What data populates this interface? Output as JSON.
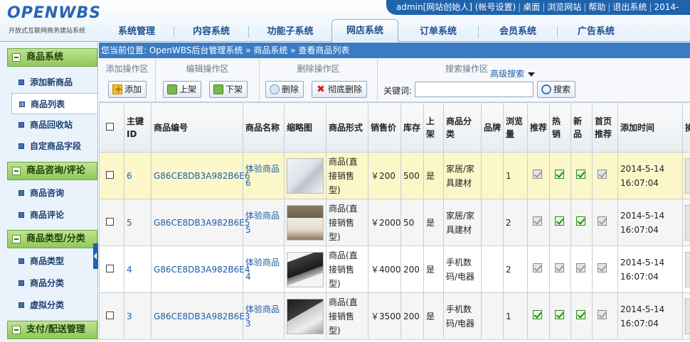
{
  "logo": {
    "brand": "OPENWBS",
    "tagline": "开放式互联网商务建站系统"
  },
  "topbar": {
    "links": [
      "admin[网站创始人] (帐号设置)",
      "桌面",
      "浏览网站",
      "帮助",
      "退出系统",
      "2014-"
    ]
  },
  "nav": {
    "tabs": [
      "系统管理",
      "内容系统",
      "功能子系统",
      "网店系统",
      "订单系统",
      "会员系统",
      "广告系统"
    ],
    "active": "网店系统"
  },
  "sidebar": {
    "sections": [
      {
        "title": "商品系统",
        "items": [
          "添加新商品",
          "商品列表",
          "商品回收站",
          "自定商品字段"
        ]
      },
      {
        "title": "商品咨询/评论",
        "items": [
          "商品咨询",
          "商品评论"
        ]
      },
      {
        "title": "商品类型/分类",
        "items": [
          "商品类型",
          "商品分类",
          "虚拟分类"
        ]
      },
      {
        "title": "支付/配送管理",
        "items": []
      }
    ],
    "active_item": "商品列表"
  },
  "breadcrumb": "您当前位置: OpenWBS后台管理系统 » 商品系统 » 查看商品列表",
  "toolbar": {
    "add_group": "添加操作区",
    "add_btn": "添加",
    "edit_group": "编辑操作区",
    "up_btn": "上架",
    "down_btn": "下架",
    "delete_group": "删除操作区",
    "delete_btn": "删除",
    "purge_btn": "彻底删除",
    "search_group": "搜索操作区",
    "advanced_search": "高级搜索",
    "keyword_label": "关键词:",
    "keyword_value": "",
    "search_btn": "搜索"
  },
  "table": {
    "headers": [
      "主键ID",
      "商品编号",
      "商品名称",
      "缩略图",
      "商品形式",
      "销售价",
      "库存",
      "上架",
      "商品分类",
      "品牌",
      "浏览量",
      "推荐",
      "热销",
      "新品",
      "首页推荐",
      "添加时间",
      "操"
    ],
    "rows": [
      {
        "id": "6",
        "code": "G86CE8DB3A982B6E6",
        "name": "体验商品6",
        "thumb": "chair-thumbnail",
        "form": "商品(直接销售型)",
        "price": "￥200",
        "stock": "500",
        "onsale": "是",
        "category": "家居/家具建材",
        "brand": "",
        "views": "1",
        "recommend": false,
        "hot": true,
        "new": true,
        "home": false,
        "date": "2014-5-14",
        "time": "16:07:04"
      },
      {
        "id": "5",
        "code": "G86CE8DB3A982B6E5",
        "name": "体验商品5",
        "thumb": "bed-thumbnail",
        "form": "商品(直接销售型)",
        "price": "￥2000",
        "stock": "50",
        "onsale": "是",
        "category": "家居/家具建材",
        "brand": "",
        "views": "2",
        "recommend": false,
        "hot": true,
        "new": true,
        "home": false,
        "date": "2014-5-14",
        "time": "16:07:04"
      },
      {
        "id": "4",
        "code": "G86CE8DB3A982B6E4",
        "name": "体验商品4",
        "thumb": "laptop-thumbnail",
        "form": "商品(直接销售型)",
        "price": "￥4000",
        "stock": "200",
        "onsale": "是",
        "category": "手机数码/电器",
        "brand": "",
        "views": "2",
        "recommend": false,
        "hot": false,
        "new": false,
        "home": false,
        "date": "2014-5-14",
        "time": "16:07:04"
      },
      {
        "id": "3",
        "code": "G86CE8DB3A982B6E3",
        "name": "体验商品3",
        "thumb": "keyboard-thumbnail",
        "form": "商品(直接销售型)",
        "price": "￥3500",
        "stock": "200",
        "onsale": "是",
        "category": "手机数码/电器",
        "brand": "",
        "views": "1",
        "recommend": true,
        "hot": true,
        "new": true,
        "home": false,
        "date": "2014-5-14",
        "time": "16:07:04"
      }
    ]
  }
}
